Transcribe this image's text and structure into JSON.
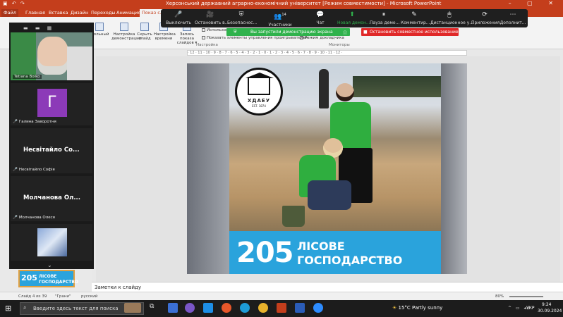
{
  "window": {
    "title": "Херсонський державний аграрно-економічний університет [Режим совместимости]  -  Microsoft PowerPoint",
    "quick_access": "▣ ↶ ↷",
    "controls": "– ▢ ✕"
  },
  "tabs": [
    "Файл",
    "Главная",
    "Вставка",
    "Дизайн",
    "Переходы",
    "Анимация",
    "Показ слайдов"
  ],
  "active_tab": 6,
  "ribbon": {
    "buttons": [
      {
        "label": "...ольный"
      },
      {
        "label": "Настройка демонстрации"
      },
      {
        "label": "Скрыть слайд"
      },
      {
        "label": "Настройка времени"
      },
      {
        "label": "Запись показа слайдов ▾"
      }
    ],
    "checkboxes": [
      "Использов...",
      "Показать элементы управления проигрывателем",
      "Режим докладчика"
    ],
    "groups": [
      "Настройка",
      "Мониторы"
    ]
  },
  "zoom_toolbar": {
    "items": [
      {
        "icon": "mic-icon",
        "glyph": "🎤",
        "label": "Выключить"
      },
      {
        "icon": "video-icon",
        "glyph": "🎥",
        "label": "Остановить в..."
      },
      {
        "icon": "shield-icon",
        "glyph": "⛨",
        "label": "Безопаснос..."
      },
      {
        "icon": "participants-icon",
        "glyph": "👥",
        "label": "Участники",
        "count": "14"
      },
      {
        "icon": "chat-icon",
        "glyph": "💬",
        "label": "Чат"
      },
      {
        "icon": "share-icon",
        "glyph": "⬆",
        "label": "Новая демон..."
      },
      {
        "icon": "pause-icon",
        "glyph": "⏸",
        "label": "Пауза демо..."
      },
      {
        "icon": "annotate-icon",
        "glyph": "✎",
        "label": "Комментир..."
      },
      {
        "icon": "remote-control-icon",
        "glyph": "🖱",
        "label": "Дистанционное у..."
      },
      {
        "icon": "apps-icon",
        "glyph": "⟳",
        "label": "Приложения"
      },
      {
        "icon": "more-icon",
        "glyph": "⋯",
        "label": "Дополнит..."
      }
    ],
    "share_banner": "Вы запустили демонстрацию экрана",
    "stop_button": "Остановить совместное использование"
  },
  "ruler": "· 12 · 11 · 10 · 9 · 8 · 7 · 6 · 5 · 4 · 3 · 2 · 1 · 0 · 1 · 2 · 3 · 4 · 5 · 6 · 7 · 8 · 9 · 10 · 11 · 12 ·",
  "slide": {
    "logo_text": "ХДАЕУ",
    "logo_year": "EST. 1874",
    "banner_number": "205",
    "banner_line1": "ЛІСОВЕ",
    "banner_line2": "ГОСПОДАРСТВО"
  },
  "thumb_selected": {
    "number": "205",
    "line1": "ЛІСОВЕ",
    "line2": "ГОСПОДАРСТВО"
  },
  "notes_placeholder": "Заметки к слайду",
  "statusbar": {
    "slide_info": "Слайд 4 из 39",
    "theme": "\"Грани\"",
    "language": "русский",
    "zoom": "80%"
  },
  "zoom_panel": {
    "participants": [
      {
        "name": "Tetiana Boiko",
        "type": "video"
      },
      {
        "name": "Галина Заворотня",
        "type": "avatar",
        "initial": "Г",
        "color": "#8c3ab8"
      },
      {
        "name": "Несвітайло Софія",
        "display": "Несвітайло Со...",
        "type": "text"
      },
      {
        "name": "Молчанова Олеся",
        "display": "Молчанова Ол...",
        "type": "text"
      },
      {
        "name": "",
        "type": "image"
      }
    ]
  },
  "taskbar": {
    "search_placeholder": "Введите здесь текст для поиска",
    "weather": "15°C  Partly sunny",
    "language": "УКР",
    "time": "9:24",
    "date": "30.09.2024"
  }
}
